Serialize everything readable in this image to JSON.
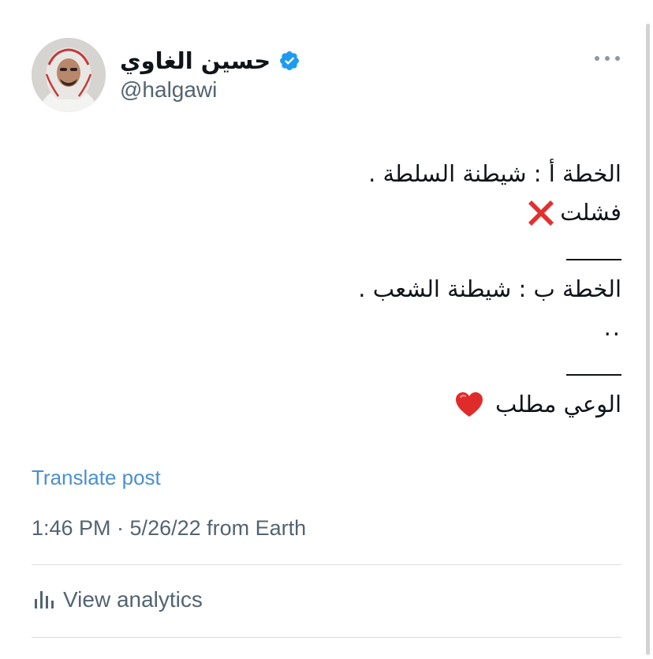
{
  "author": {
    "display_name": "حسين الغاوي",
    "handle": "@halgawi",
    "verified": true,
    "verified_color": "#1d9bf0",
    "avatar_icon": "profile-photo"
  },
  "tweet": {
    "lines": [
      "الخطة أ : شيطنة السلطة .",
      "فشلت",
      "الخطة ب : شيطنة الشعب .",
      "..",
      "الوعي مطلب"
    ],
    "emoji": {
      "cross": "cross-mark-emoji",
      "heart": "red-heart-emoji"
    }
  },
  "translate_label": "Translate post",
  "meta": "1:46 PM · 5/26/22 from Earth",
  "analytics_label": "View analytics",
  "colors": {
    "link": "#1d9bf0",
    "secondary_text": "#536471",
    "text": "#0f1419"
  }
}
